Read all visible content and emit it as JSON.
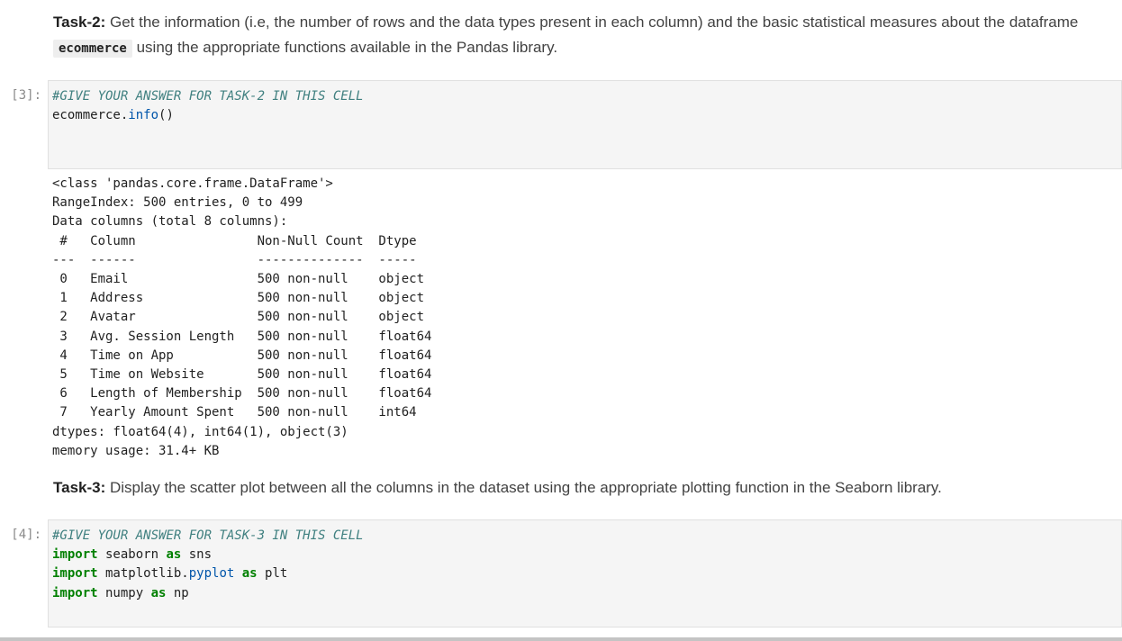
{
  "task2": {
    "title": "Task-2:",
    "text_before": " Get the information (i.e, the number of rows and the data types present in each column) and the basic statistical measures about the dataframe ",
    "code_word": "ecommerce",
    "text_after": " using the appropriate functions available in the Pandas library."
  },
  "cell3": {
    "prompt": "[3]:",
    "comment": "#GIVE YOUR ANSWER FOR TASK-2 IN THIS CELL",
    "line2_obj": "ecommerce.",
    "line2_fn": "info",
    "line2_paren": "()"
  },
  "output3": {
    "lines": [
      "<class 'pandas.core.frame.DataFrame'>",
      "RangeIndex: 500 entries, 0 to 499",
      "Data columns (total 8 columns):",
      " #   Column                Non-Null Count  Dtype  ",
      "---  ------                --------------  -----  ",
      " 0   Email                 500 non-null    object ",
      " 1   Address               500 non-null    object ",
      " 2   Avatar                500 non-null    object ",
      " 3   Avg. Session Length   500 non-null    float64",
      " 4   Time on App           500 non-null    float64",
      " 5   Time on Website       500 non-null    float64",
      " 6   Length of Membership  500 non-null    float64",
      " 7   Yearly Amount Spent   500 non-null    int64  ",
      "dtypes: float64(4), int64(1), object(3)",
      "memory usage: 31.4+ KB"
    ]
  },
  "task3": {
    "title": "Task-3:",
    "text": " Display the scatter plot between all the columns in the dataset using the appropriate plotting function in the Seaborn library."
  },
  "cell4": {
    "prompt": "[4]:",
    "comment": "#GIVE YOUR ANSWER FOR TASK-3 IN THIS CELL",
    "import_kw": "import",
    "as_kw": "as",
    "l1_mod": " seaborn ",
    "l1_alias": " sns",
    "l2_mod_a": " matplotlib.",
    "l2_mod_b": "pyplot",
    "l2_mod_c": " ",
    "l2_alias": " plt",
    "l3_mod": " numpy ",
    "l3_alias": " np"
  }
}
